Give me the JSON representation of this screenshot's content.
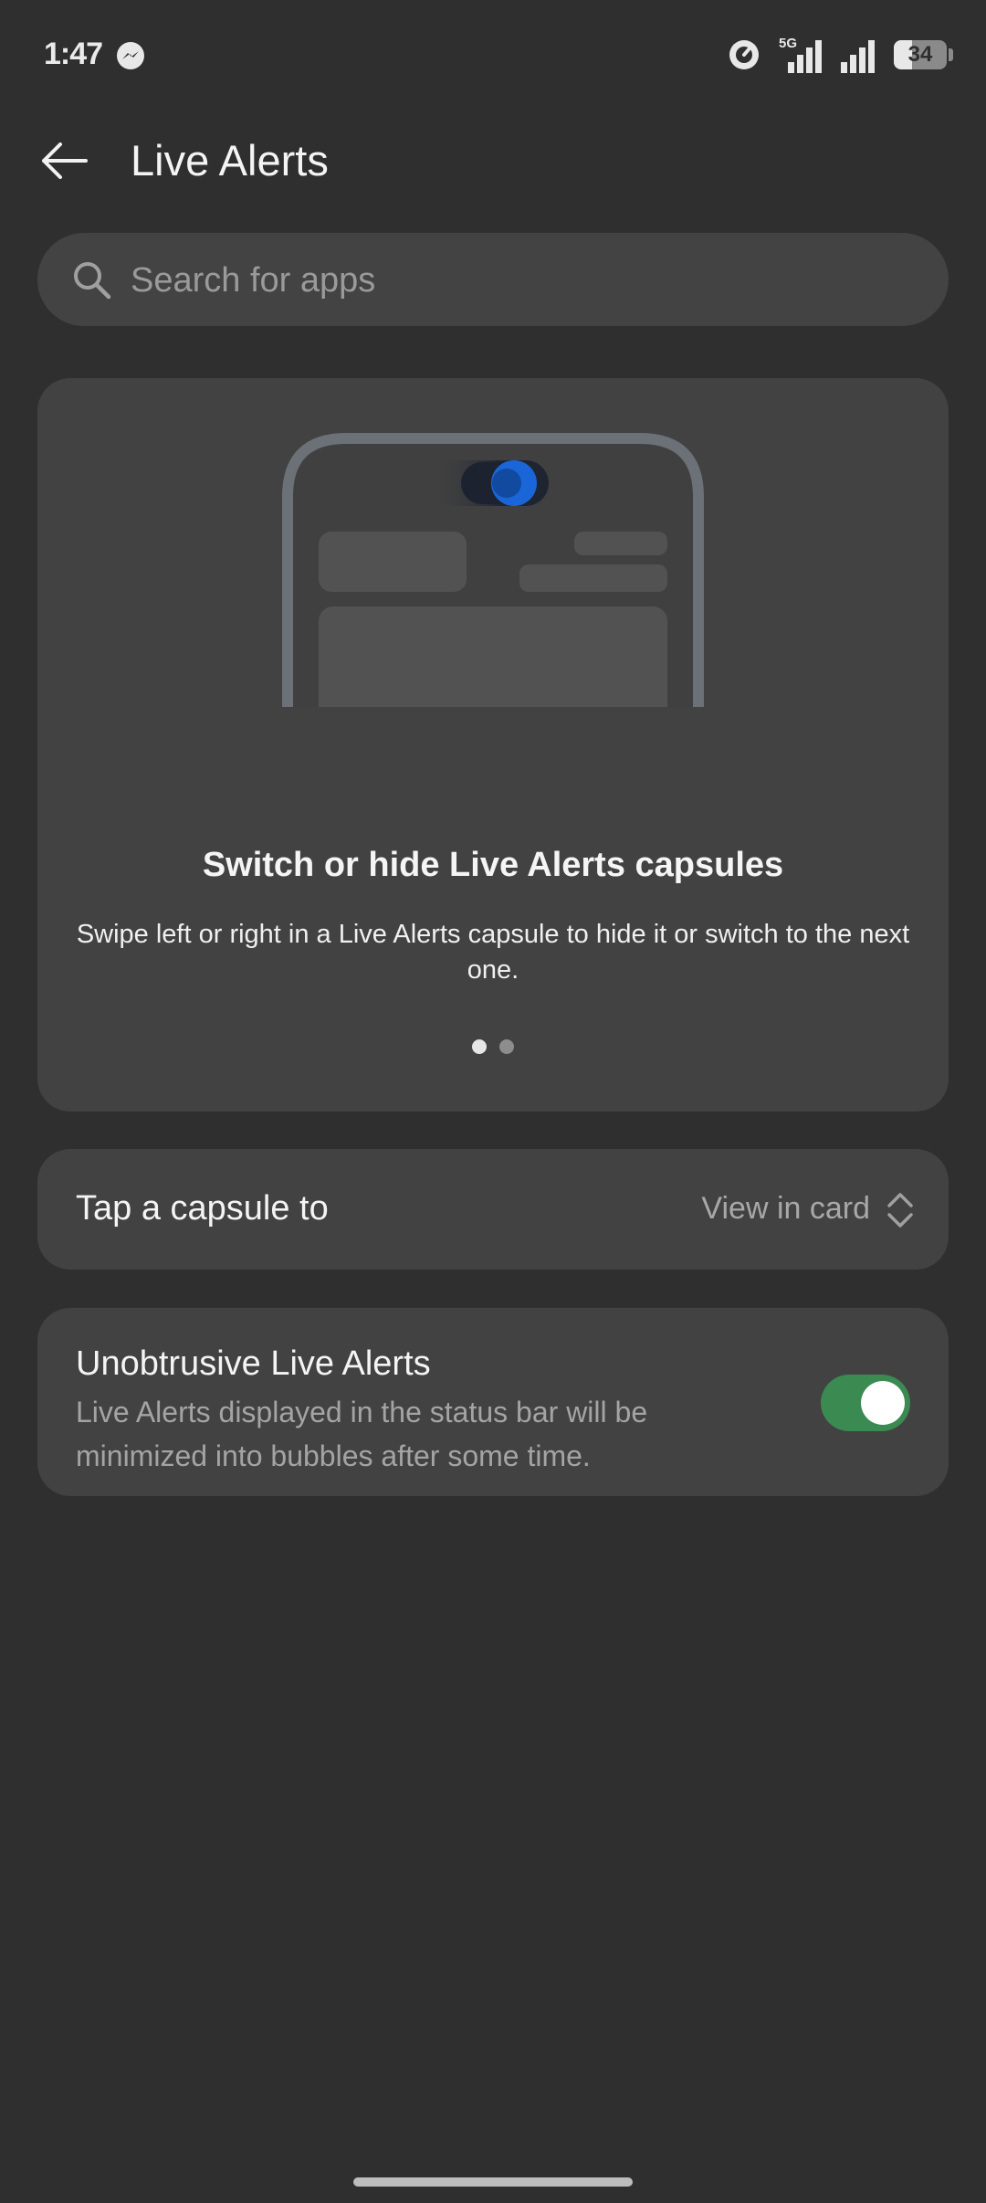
{
  "status_bar": {
    "time": "1:47",
    "network": "5G",
    "battery": "34",
    "icons": [
      "messenger-icon",
      "data-saver-icon",
      "signal-5g-icon",
      "signal-icon",
      "battery-icon"
    ]
  },
  "header": {
    "title": "Live Alerts",
    "back_icon": "arrow-left-icon"
  },
  "search": {
    "placeholder": "Search for apps",
    "value": "",
    "icon": "search-icon"
  },
  "tips_card": {
    "title": "Switch or hide Live Alerts capsules",
    "description": "Swipe left or right in a Live Alerts capsule to hide it or switch to the next one.",
    "page_count": 2,
    "active_page": 1,
    "capsule_color": "#1a66d8"
  },
  "tap_capsule": {
    "label": "Tap a capsule to",
    "value": "View in card",
    "icon": "chevron-up-down-icon"
  },
  "unobtrusive": {
    "label": "Unobtrusive Live Alerts",
    "description": "Live Alerts displayed in the status bar will be minimized into bubbles after some time.",
    "enabled": true,
    "accent_color": "#3a8a52"
  }
}
